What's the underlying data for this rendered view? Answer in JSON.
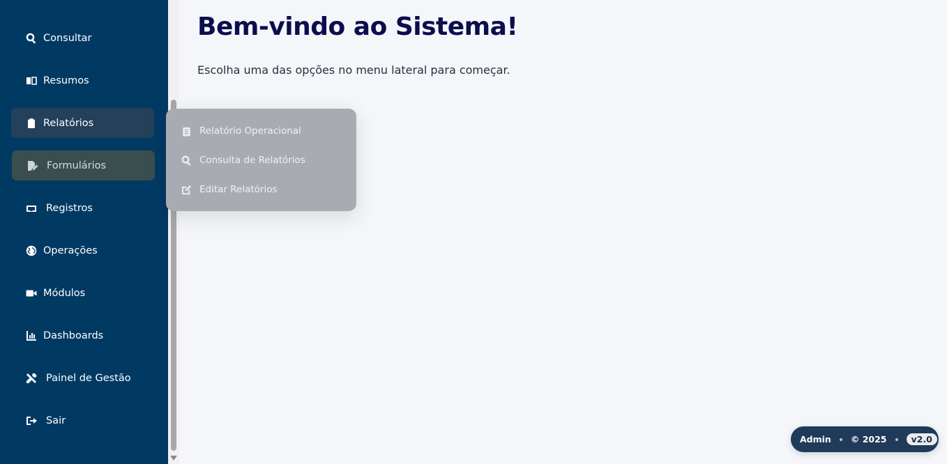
{
  "sidebar": {
    "items": [
      {
        "label": "Consultar",
        "icon": "search-icon"
      },
      {
        "label": "Resumos",
        "icon": "book-icon"
      },
      {
        "label": "Relatórios",
        "icon": "clipboard-icon"
      },
      {
        "label": "Formulários",
        "icon": "file-edit-icon"
      },
      {
        "label": "Registros",
        "icon": "inbox-icon"
      },
      {
        "label": "Operações",
        "icon": "globe-icon"
      },
      {
        "label": "Módulos",
        "icon": "video-icon"
      },
      {
        "label": "Dashboards",
        "icon": "chart-icon"
      },
      {
        "label": "Painel de Gestão",
        "icon": "tools-icon"
      },
      {
        "label": "Sair",
        "icon": "sign-out-icon"
      }
    ]
  },
  "submenu": {
    "items": [
      {
        "label": "Relatório Operacional",
        "icon": "clipboard-list-icon"
      },
      {
        "label": "Consulta de Relatórios",
        "icon": "search-icon"
      },
      {
        "label": "Editar Relatórios",
        "icon": "edit-icon"
      }
    ]
  },
  "main": {
    "title": "Bem-vindo ao Sistema!",
    "subtitle": "Escolha uma das opções no menu lateral para começar."
  },
  "footer": {
    "user": "Admin",
    "copyright": "© 2025",
    "version": "v2.0"
  }
}
